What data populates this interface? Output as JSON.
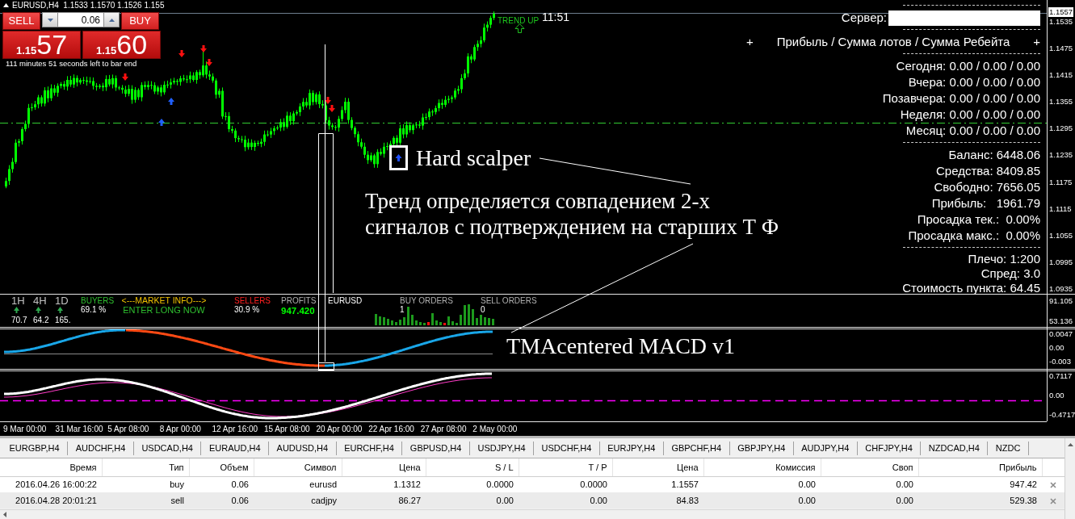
{
  "chart_window": {
    "title": "EURUSD,H4  1.1533 1.1570 1.1526 1.155",
    "clock": "11:51",
    "trend_label": "TREND UP"
  },
  "trade_panel": {
    "sell_label": "SELL",
    "volume": "0.06",
    "buy_label": "BUY",
    "sell_price": {
      "prefix": "1.15",
      "main": "57"
    },
    "buy_price": {
      "prefix": "1.15",
      "main": "60"
    },
    "bar_timer": "111 minutes 51 seconds left to bar end"
  },
  "account_panel": {
    "server_label": "Сервер:",
    "header": {
      "left_mark": "+",
      "title": "Прибыль / Сумма лотов / Сумма Ребейта",
      "right_mark": "+"
    },
    "period_rows": [
      "Сегодня: 0.00 / 0.00 / 0.00",
      "Вчера: 0.00 / 0.00 / 0.00",
      "Позавчера: 0.00 / 0.00 / 0.00",
      "Неделя: 0.00 / 0.00 / 0.00",
      "Месяц: 0.00 / 0.00 / 0.00"
    ],
    "account_rows": [
      "Баланс: 6448.06",
      "Средства: 8409.85",
      "Свободно: 7656.05",
      "Прибыль:   1961.79",
      "Просадка тек.:  0.00%",
      "Просадка макс.:  0.00%"
    ],
    "trading_rows": [
      "Плечо: 1:200",
      "Спред: 3.0",
      "Стоимость пункта: 64.45"
    ]
  },
  "annotations": {
    "signal_label": "Hard scalper",
    "note_lines": [
      "Тренд определяется совпадением 2-х",
      "сигналов с подтверждением на старших Т Ф"
    ],
    "indicator_label": "TMAcentered MACD v1"
  },
  "price_axis": {
    "current_price": "1.1557",
    "labels": [
      "1.1535",
      "1.1475",
      "1.1415",
      "1.1355",
      "1.1295",
      "1.1235",
      "1.1175",
      "1.1115",
      "1.1055",
      "1.0995",
      "1.0935"
    ]
  },
  "market_info": {
    "timeframes": [
      {
        "label": "1H",
        "value": "70.7"
      },
      {
        "label": "4H",
        "value": "64.2"
      },
      {
        "label": "1D",
        "value": "165."
      }
    ],
    "buyers": {
      "label": "BUYERS",
      "value": "69.1 %"
    },
    "title": "<---MARKET INFO--->",
    "signal": "ENTER LONG NOW",
    "sellers": {
      "label": "SELLERS",
      "value": "30.9 %"
    },
    "profits": {
      "label": "PROFITS",
      "value": "947.420"
    },
    "symbol": "EURUSD",
    "buy_orders": {
      "label": "BUY ORDERS",
      "value": "1"
    },
    "sell_orders": {
      "label": "SELL ORDERS",
      "value": "0"
    },
    "axis_labels": [
      "91.105",
      "53.136"
    ]
  },
  "macd_window": {
    "axis_labels": [
      "0.0047",
      "0.00",
      "-0.003"
    ]
  },
  "oscillator_window": {
    "axis_labels": [
      "0.7117",
      "0.00",
      "-0.4717"
    ]
  },
  "time_axis": {
    "labels": [
      "9 Mar 00:00",
      "31 Mar 16:00",
      "5 Apr 08:00",
      "8 Apr 00:00",
      "12 Apr 16:00",
      "15 Apr 08:00",
      "20 Apr 00:00",
      "22 Apr 16:00",
      "27 Apr 08:00",
      "2 May 00:00"
    ]
  },
  "symbol_tabs": [
    {
      "label": "EURGBP,H4",
      "selected": false
    },
    {
      "label": "AUDCHF,H4",
      "selected": false
    },
    {
      "label": "USDCAD,H4",
      "selected": false
    },
    {
      "label": "EURAUD,H4",
      "selected": false
    },
    {
      "label": "AUDUSD,H4",
      "selected": false
    },
    {
      "label": "EURCHF,H4",
      "selected": false
    },
    {
      "label": "GBPUSD,H4",
      "selected": false
    },
    {
      "label": "USDJPY,H4",
      "selected": false
    },
    {
      "label": "USDCHF,H4",
      "selected": false
    },
    {
      "label": "EURJPY,H4",
      "selected": false
    },
    {
      "label": "GBPCHF,H4",
      "selected": false
    },
    {
      "label": "GBPJPY,H4",
      "selected": false
    },
    {
      "label": "AUDJPY,H4",
      "selected": false
    },
    {
      "label": "CHFJPY,H4",
      "selected": false
    },
    {
      "label": "NZDCAD,H4",
      "selected": false
    },
    {
      "label": "NZDC",
      "selected": false
    }
  ],
  "trades_table": {
    "columns": [
      "Время",
      "Тип",
      "Объем",
      "Символ",
      "Цена",
      "S / L",
      "T / P",
      "Цена",
      "Комиссия",
      "Своп",
      "Прибыль"
    ],
    "rows": [
      {
        "cells": [
          "2016.04.26 16:00:22",
          "buy",
          "0.06",
          "eurusd",
          "1.1312",
          "0.0000",
          "0.0000",
          "1.1557",
          "0.00",
          "0.00",
          "947.42"
        ]
      },
      {
        "cells": [
          "2016.04.28 20:01:21",
          "sell",
          "0.06",
          "cadjpy",
          "86.27",
          "0.00",
          "0.00",
          "84.83",
          "0.00",
          "0.00",
          "529.38"
        ]
      }
    ]
  }
}
